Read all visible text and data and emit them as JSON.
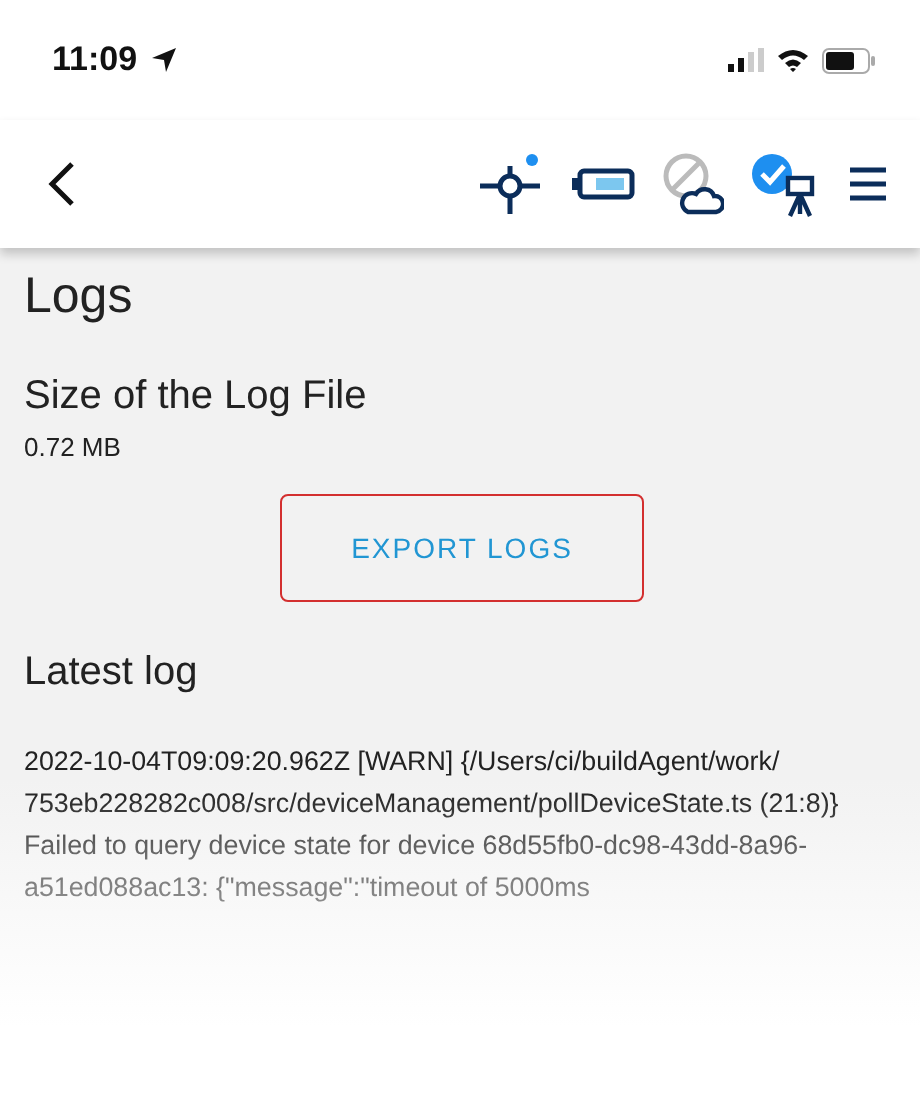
{
  "status_bar": {
    "time": "11:09"
  },
  "page": {
    "title": "Logs",
    "size_label": "Size of the Log File",
    "size_value": "0.72 MB",
    "export_button": "EXPORT LOGS",
    "latest_label": "Latest log",
    "latest_log": "2022-10-04T09:09:20.962Z [WARN] {/Users/ci/buildAgent/work/753eb228282c008/src/deviceManagement/pollDeviceState.ts (21:8)} Failed to query device state for device 68d55fb0-dc98-43dd-8a96-a51ed088ac13: {\"message\":\"timeout of 5000ms"
  }
}
